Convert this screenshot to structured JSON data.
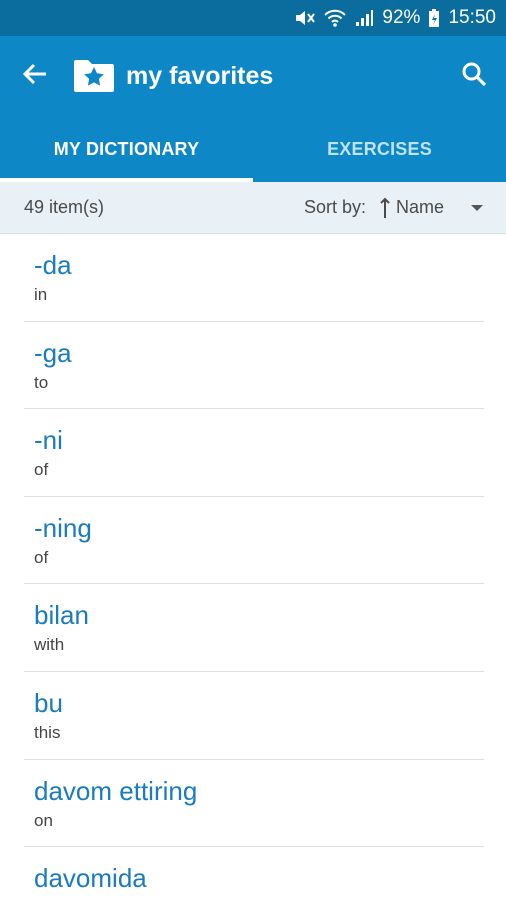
{
  "status_bar": {
    "battery": "92%",
    "time": "15:50",
    "icons": [
      "mute-icon",
      "wifi-icon",
      "signal-icon",
      "battery-icon"
    ]
  },
  "app_bar": {
    "title": "my favorites",
    "back_icon": "arrow-left-icon",
    "logo_icon": "star-folder-icon",
    "search_icon": "search-icon"
  },
  "tabs": [
    {
      "label": "MY DICTIONARY",
      "active": true
    },
    {
      "label": "EXERCISES",
      "active": false
    }
  ],
  "sort_bar": {
    "count": "49 item(s)",
    "sort_label": "Sort by:",
    "sort_value": "Name",
    "sort_direction_icon": "arrow-up-icon",
    "dropdown_icon": "triangle-down-icon"
  },
  "words": [
    {
      "term": "-da",
      "translation": "in"
    },
    {
      "term": "-ga",
      "translation": "to"
    },
    {
      "term": "-ni",
      "translation": "of"
    },
    {
      "term": "-ning",
      "translation": "of"
    },
    {
      "term": "bilan",
      "translation": "with"
    },
    {
      "term": "bu",
      "translation": "this"
    },
    {
      "term": "davom ettiring",
      "translation": "on"
    },
    {
      "term": "davomida",
      "translation": ""
    }
  ],
  "colors": {
    "status_bar": "#0a6d9e",
    "primary": "#0e87c6",
    "term_text": "#1a7bbf",
    "sort_bar_bg": "#e9f1f7"
  }
}
